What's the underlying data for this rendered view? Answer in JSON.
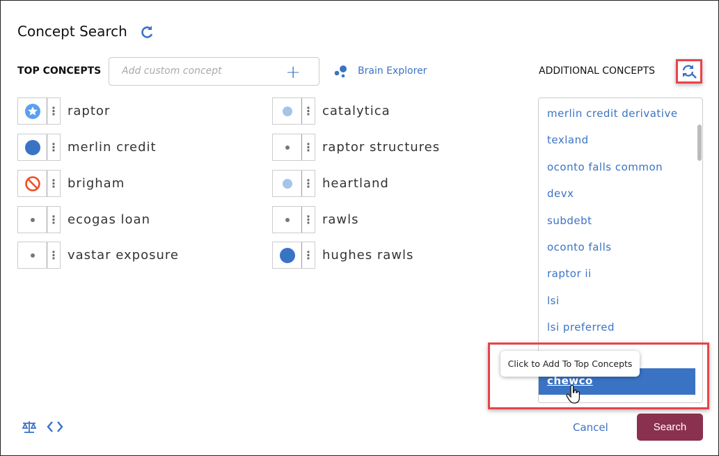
{
  "title": "Concept Search",
  "top_concepts": {
    "label": "TOP CONCEPTS",
    "input_placeholder": "Add custom concept",
    "add_symbol": "+",
    "brain_explorer": "Brain Explorer",
    "left": [
      {
        "label": "raptor",
        "icon": "star-icon"
      },
      {
        "label": "merlin credit",
        "icon": "large-dot-icon"
      },
      {
        "label": "brigham",
        "icon": "ban-icon"
      },
      {
        "label": "ecogas loan",
        "icon": "small-dot-icon"
      },
      {
        "label": "vastar exposure",
        "icon": "small-dot-icon"
      }
    ],
    "right": [
      {
        "label": "catalytica",
        "icon": "medium-dot-icon"
      },
      {
        "label": "raptor structures",
        "icon": "small-dot-icon"
      },
      {
        "label": "heartland",
        "icon": "medium-dot-icon"
      },
      {
        "label": "rawls",
        "icon": "small-dot-icon"
      },
      {
        "label": "hughes rawls",
        "icon": "large-dot-icon"
      }
    ]
  },
  "additional": {
    "label": "ADDITIONAL CONCEPTS",
    "items": [
      "merlin credit derivative",
      "texland",
      "oconto falls common",
      "devx",
      "subdebt",
      "oconto falls",
      "raptor ii",
      "lsi",
      "lsi preferred",
      ""
    ],
    "highlighted": "chewco",
    "tooltip": "Click to Add To Top Concepts"
  },
  "footer": {
    "cancel": "Cancel",
    "search": "Search"
  },
  "colors": {
    "accent": "#3a73c4",
    "search_button": "#8b3150",
    "highlight_box": "#e8434a",
    "ban": "#f04e23"
  }
}
